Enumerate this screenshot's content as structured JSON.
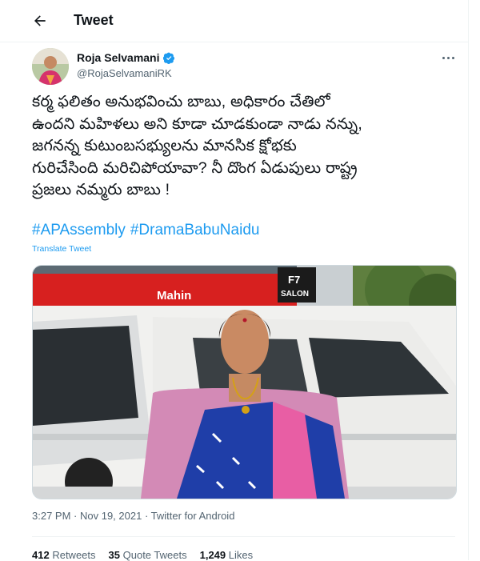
{
  "header": {
    "title": "Tweet"
  },
  "author": {
    "name": "Roja Selvamani",
    "handle": "@RojaSelvamaniRK",
    "verified": true
  },
  "tweet": {
    "text_lines": [
      "కర్మ ఫలితం అనుభవించు బాబు, అధికారం చేతిలో",
      "ఉందని మహిళలు అని కూడా చూడకుండా నాడు నన్ను,",
      "జగనన్న కుటుంబసభ్యులను మానసిక క్షోభకు",
      "గురిచేసింది మరిచిపోయావా? నీ దొంగ ఏడుపులు రాష్ట్ర",
      "ప్రజలు నమ్మరు బాబు !"
    ],
    "hashtags": [
      "#APAssembly",
      "#DramaBabuNaidu"
    ],
    "translate_label": "Translate Tweet",
    "media": {
      "sign_left": "Mahin",
      "sign_right_top": "F7",
      "sign_right_bottom": "SALON"
    },
    "time": "3:27 PM",
    "date": "Nov 19, 2021",
    "source": "Twitter for Android"
  },
  "stats": {
    "retweets_count": "412",
    "retweets_label": "Retweets",
    "quotes_count": "35",
    "quotes_label": "Quote Tweets",
    "likes_count": "1,249",
    "likes_label": "Likes"
  },
  "colors": {
    "accent": "#1d9bf0",
    "secondary_text": "#536471",
    "primary_text": "#0f1419"
  }
}
